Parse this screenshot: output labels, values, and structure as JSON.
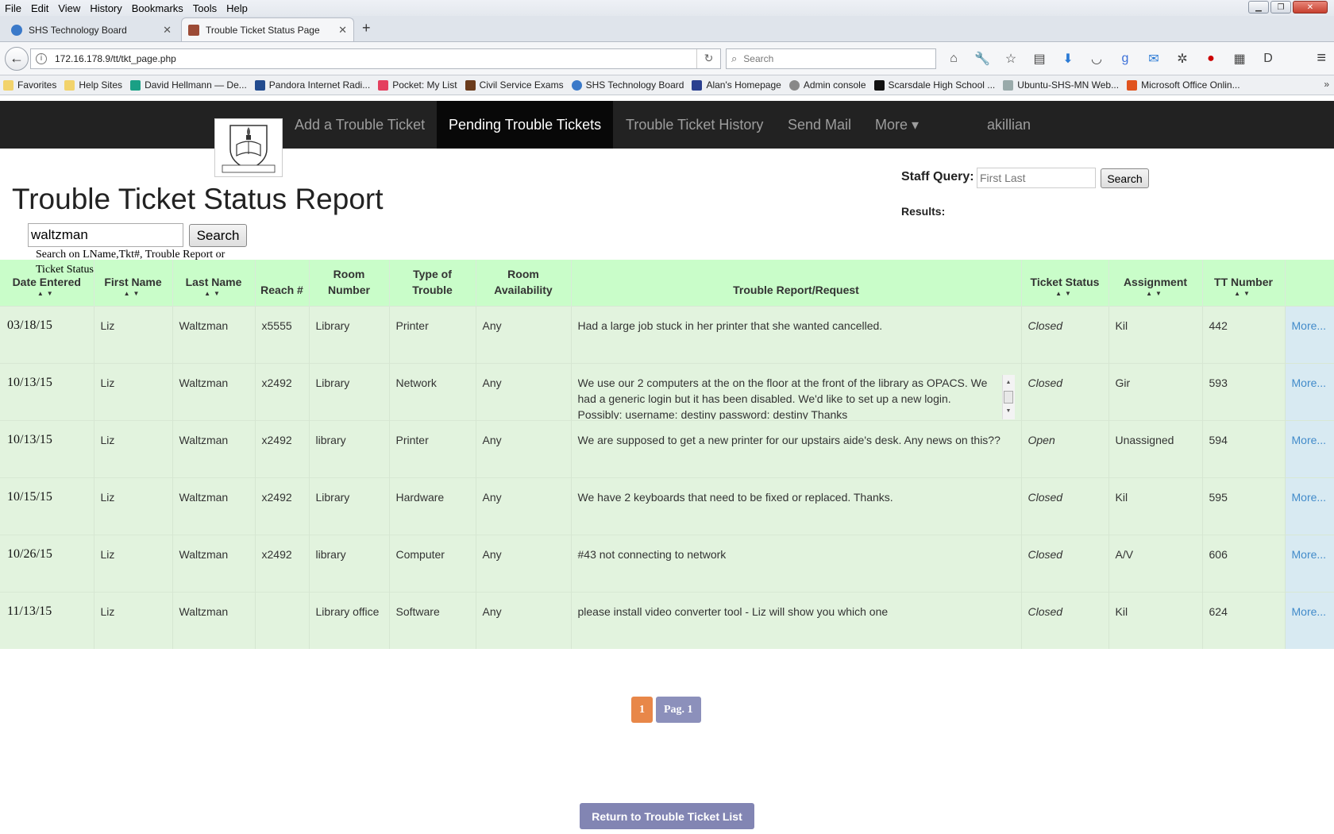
{
  "browser": {
    "menu": [
      "File",
      "Edit",
      "View",
      "History",
      "Bookmarks",
      "Tools",
      "Help"
    ],
    "tabs": [
      {
        "label": "SHS Technology Board"
      },
      {
        "label": "Trouble Ticket Status Page"
      }
    ],
    "url": "172.16.178.9/tt/tkt_page.php",
    "search_placeholder": "Search",
    "bookmarks": [
      "Favorites",
      "Help Sites",
      "David Hellmann — De...",
      "Pandora Internet Radi...",
      "Pocket: My List",
      "Civil Service Exams",
      "SHS Technology Board",
      "Alan's Homepage",
      "Admin console",
      "Scarsdale High School ...",
      "Ubuntu-SHS-MN Web...",
      "Microsoft Office Onlin..."
    ]
  },
  "nav": {
    "add": "Add a Trouble Ticket",
    "pending": "Pending Trouble Tickets",
    "history": "Trouble Ticket History",
    "mail": "Send Mail",
    "more": "More ▾",
    "user": "akillian"
  },
  "page": {
    "title": "Trouble Ticket Status Report",
    "search_value": "waltzman",
    "search_button": "Search",
    "search_hint": "Search on LName,Tkt#, Trouble Report or Ticket Status",
    "staff_query_label": "Staff Query:",
    "staff_placeholder": "First Last",
    "staff_button": "Search",
    "results_label": "Results:"
  },
  "table": {
    "headers": [
      "Date Entered",
      "First Name",
      "Last Name",
      "Reach #",
      "Room Number",
      "Type of Trouble",
      "Room Availability",
      "Trouble Report/Request",
      "Ticket Status",
      "Assignment",
      "TT Number",
      ""
    ],
    "rows": [
      {
        "date": "03/18/15",
        "first": "Liz",
        "last": "Waltzman",
        "reach": "x5555",
        "room": "Library",
        "type": "Printer",
        "avail": "Any",
        "report": "Had a large job stuck in her printer that she wanted cancelled.",
        "status": "Closed",
        "assign": "Kil",
        "tt": "442",
        "more": "More..."
      },
      {
        "date": "10/13/15",
        "first": "Liz",
        "last": "Waltzman",
        "reach": "x2492",
        "room": "Library",
        "type": "Network",
        "avail": "Any",
        "report": "We use our 2 computers at the on the floor at the front of the library as OPACS. We had a generic login but it has been disabled. We'd like to set up a new login. Possibly: username: destiny password: destiny Thanks",
        "status": "Closed",
        "assign": "Gir",
        "tt": "593",
        "more": "More..."
      },
      {
        "date": "10/13/15",
        "first": "Liz",
        "last": "Waltzman",
        "reach": "x2492",
        "room": "library",
        "type": "Printer",
        "avail": "Any",
        "report": "We are supposed to get a new printer for our upstairs aide's desk. Any news on this??",
        "status": "Open",
        "assign": "Unassigned",
        "tt": "594",
        "more": "More..."
      },
      {
        "date": "10/15/15",
        "first": "Liz",
        "last": "Waltzman",
        "reach": "x2492",
        "room": "Library",
        "type": "Hardware",
        "avail": "Any",
        "report": "We have 2 keyboards that need to be fixed or replaced. Thanks.",
        "status": "Closed",
        "assign": "Kil",
        "tt": "595",
        "more": "More..."
      },
      {
        "date": "10/26/15",
        "first": "Liz",
        "last": "Waltzman",
        "reach": "x2492",
        "room": "library",
        "type": "Computer",
        "avail": "Any",
        "report": "#43 not connecting to network",
        "status": "Closed",
        "assign": "A/V",
        "tt": "606",
        "more": "More..."
      },
      {
        "date": "11/13/15",
        "first": "Liz",
        "last": "Waltzman",
        "reach": "",
        "room": "Library office",
        "type": "Software",
        "avail": "Any",
        "report": "please install video converter tool - Liz will show you which one",
        "status": "Closed",
        "assign": "Kil",
        "tt": "624",
        "more": "More..."
      }
    ]
  },
  "pager": {
    "current": "1",
    "label": "Pag. 1"
  },
  "return_button": "Return to Trouble Ticket List"
}
